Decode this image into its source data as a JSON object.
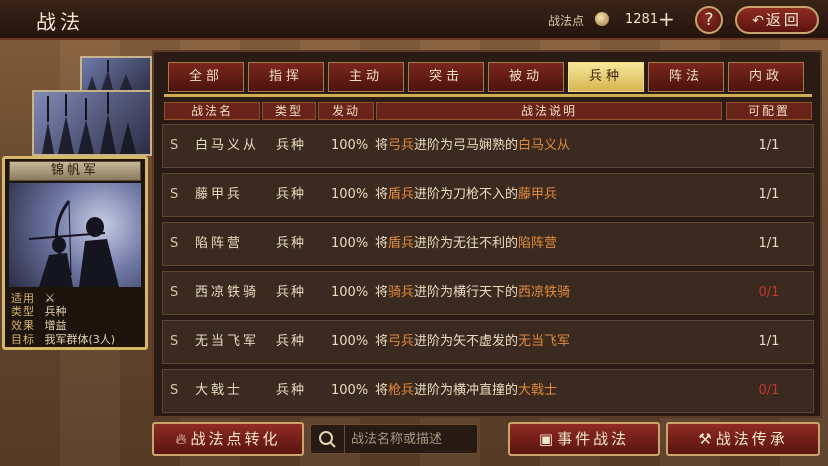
{
  "header": {
    "title": "战法",
    "points_label": "战法点",
    "points_value": "1281",
    "plus": "+",
    "help": "?",
    "back_label": "返回"
  },
  "card": {
    "name": "锦帆军",
    "rows": [
      {
        "key": "适用",
        "value": ""
      },
      {
        "key": "类型",
        "value": "兵种"
      },
      {
        "key": "效果",
        "value": "增益"
      },
      {
        "key": "目标",
        "value": "我军群体(3人)"
      }
    ]
  },
  "tabs": [
    {
      "label": "全部",
      "active": false
    },
    {
      "label": "指挥",
      "active": false
    },
    {
      "label": "主动",
      "active": false
    },
    {
      "label": "突击",
      "active": false
    },
    {
      "label": "被动",
      "active": false
    },
    {
      "label": "兵种",
      "active": true
    },
    {
      "label": "阵法",
      "active": false
    },
    {
      "label": "内政",
      "active": false
    }
  ],
  "table": {
    "headers": [
      "战法名",
      "类型",
      "发动",
      "战法说明",
      "可配置"
    ],
    "rows": [
      {
        "grade": "S",
        "name": "白马义从",
        "type": "兵种",
        "rate": "100%",
        "desc": [
          {
            "t": "将",
            "h": false
          },
          {
            "t": "弓兵",
            "h": true
          },
          {
            "t": "进阶为弓马娴熟的",
            "h": false
          },
          {
            "t": "白马义从",
            "h": true
          }
        ],
        "cfg": "1/1",
        "cfg_zero": false
      },
      {
        "grade": "S",
        "name": "藤甲兵",
        "type": "兵种",
        "rate": "100%",
        "desc": [
          {
            "t": "将",
            "h": false
          },
          {
            "t": "盾兵",
            "h": true
          },
          {
            "t": "进阶为刀枪不入的",
            "h": false
          },
          {
            "t": "藤甲兵",
            "h": true
          }
        ],
        "cfg": "1/1",
        "cfg_zero": false
      },
      {
        "grade": "S",
        "name": "陷阵营",
        "type": "兵种",
        "rate": "100%",
        "desc": [
          {
            "t": "将",
            "h": false
          },
          {
            "t": "盾兵",
            "h": true
          },
          {
            "t": "进阶为无往不利的",
            "h": false
          },
          {
            "t": "陷阵营",
            "h": true
          }
        ],
        "cfg": "1/1",
        "cfg_zero": false
      },
      {
        "grade": "S",
        "name": "西凉铁骑",
        "type": "兵种",
        "rate": "100%",
        "desc": [
          {
            "t": "将",
            "h": false
          },
          {
            "t": "骑兵",
            "h": true
          },
          {
            "t": "进阶为横行天下的",
            "h": false
          },
          {
            "t": "西凉铁骑",
            "h": true
          }
        ],
        "cfg": "0/1",
        "cfg_zero": true
      },
      {
        "grade": "S",
        "name": "无当飞军",
        "type": "兵种",
        "rate": "100%",
        "desc": [
          {
            "t": "将",
            "h": false
          },
          {
            "t": "弓兵",
            "h": true
          },
          {
            "t": "进阶为矢不虚发的",
            "h": false
          },
          {
            "t": "无当飞军",
            "h": true
          }
        ],
        "cfg": "1/1",
        "cfg_zero": false
      },
      {
        "grade": "S",
        "name": "大戟士",
        "type": "兵种",
        "rate": "100%",
        "desc": [
          {
            "t": "将",
            "h": false
          },
          {
            "t": "枪兵",
            "h": true
          },
          {
            "t": "进阶为横冲直撞的",
            "h": false
          },
          {
            "t": "大戟士",
            "h": true
          }
        ],
        "cfg": "0/1",
        "cfg_zero": true
      }
    ]
  },
  "footer": {
    "convert_label": "战法点转化",
    "search_placeholder": "战法名称或描述",
    "event_label": "事件战法",
    "inherit_label": "战法传承"
  },
  "colors": {
    "highlight": "#e28a3a",
    "active_tab": "#e9d36f",
    "zero_config": "#c63a2a"
  }
}
